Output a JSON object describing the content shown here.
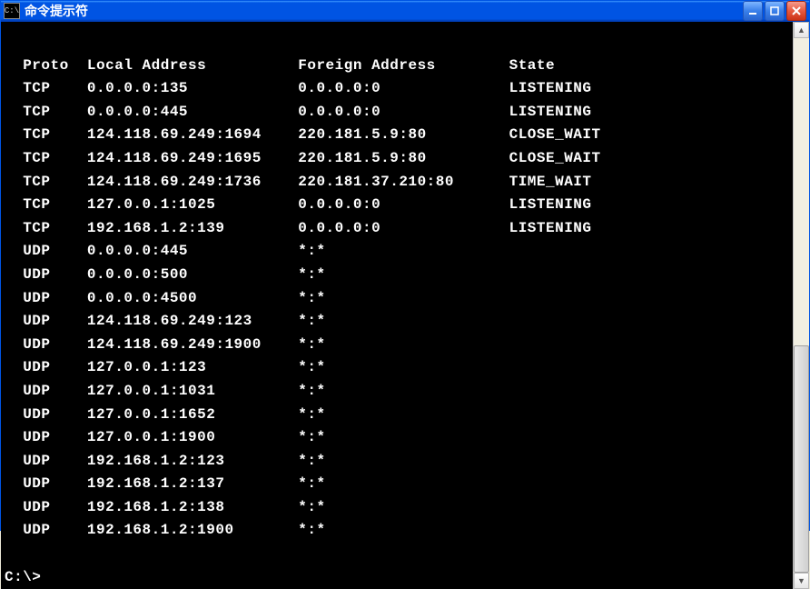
{
  "window": {
    "title": "命令提示符",
    "icon_label": "C:\\"
  },
  "headers": {
    "proto": "Proto",
    "local": "Local Address",
    "foreign": "Foreign Address",
    "state": "State"
  },
  "rows": [
    {
      "proto": "TCP",
      "local": "0.0.0.0:135",
      "foreign": "0.0.0.0:0",
      "state": "LISTENING"
    },
    {
      "proto": "TCP",
      "local": "0.0.0.0:445",
      "foreign": "0.0.0.0:0",
      "state": "LISTENING"
    },
    {
      "proto": "TCP",
      "local": "124.118.69.249:1694",
      "foreign": "220.181.5.9:80",
      "state": "CLOSE_WAIT"
    },
    {
      "proto": "TCP",
      "local": "124.118.69.249:1695",
      "foreign": "220.181.5.9:80",
      "state": "CLOSE_WAIT"
    },
    {
      "proto": "TCP",
      "local": "124.118.69.249:1736",
      "foreign": "220.181.37.210:80",
      "state": "TIME_WAIT"
    },
    {
      "proto": "TCP",
      "local": "127.0.0.1:1025",
      "foreign": "0.0.0.0:0",
      "state": "LISTENING"
    },
    {
      "proto": "TCP",
      "local": "192.168.1.2:139",
      "foreign": "0.0.0.0:0",
      "state": "LISTENING"
    },
    {
      "proto": "UDP",
      "local": "0.0.0.0:445",
      "foreign": "*:*",
      "state": ""
    },
    {
      "proto": "UDP",
      "local": "0.0.0.0:500",
      "foreign": "*:*",
      "state": ""
    },
    {
      "proto": "UDP",
      "local": "0.0.0.0:4500",
      "foreign": "*:*",
      "state": ""
    },
    {
      "proto": "UDP",
      "local": "124.118.69.249:123",
      "foreign": "*:*",
      "state": ""
    },
    {
      "proto": "UDP",
      "local": "124.118.69.249:1900",
      "foreign": "*:*",
      "state": ""
    },
    {
      "proto": "UDP",
      "local": "127.0.0.1:123",
      "foreign": "*:*",
      "state": ""
    },
    {
      "proto": "UDP",
      "local": "127.0.0.1:1031",
      "foreign": "*:*",
      "state": ""
    },
    {
      "proto": "UDP",
      "local": "127.0.0.1:1652",
      "foreign": "*:*",
      "state": ""
    },
    {
      "proto": "UDP",
      "local": "127.0.0.1:1900",
      "foreign": "*:*",
      "state": ""
    },
    {
      "proto": "UDP",
      "local": "192.168.1.2:123",
      "foreign": "*:*",
      "state": ""
    },
    {
      "proto": "UDP",
      "local": "192.168.1.2:137",
      "foreign": "*:*",
      "state": ""
    },
    {
      "proto": "UDP",
      "local": "192.168.1.2:138",
      "foreign": "*:*",
      "state": ""
    },
    {
      "proto": "UDP",
      "local": "192.168.1.2:1900",
      "foreign": "*:*",
      "state": ""
    }
  ],
  "prompt": "C:\\>"
}
